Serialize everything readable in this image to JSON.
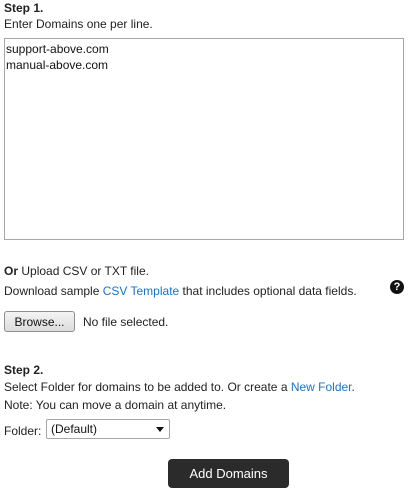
{
  "step1": {
    "heading": "Step 1.",
    "instructions": "Enter Domains one per line.",
    "domains_value": "support-above.com\nmanual-above.com"
  },
  "upload": {
    "or_label": "Or",
    "upload_text": " Upload CSV or TXT file.",
    "download_prefix": "Download sample ",
    "template_link": "CSV Template",
    "download_suffix": " that includes optional data fields.",
    "help_icon": "question-circle-icon",
    "help_glyph": "?",
    "browse_label": "Browse...",
    "file_status": "No file selected."
  },
  "step2": {
    "heading": "Step 2.",
    "folder_prefix": "Select Folder for domains to be added to. Or create a ",
    "new_folder_link": "New Folder",
    "folder_suffix": ".",
    "note": "Note: You can move a domain at anytime.",
    "folder_label": "Folder:",
    "folder_selected": "(Default)"
  },
  "actions": {
    "add_domains_label": "Add Domains"
  },
  "colors": {
    "link": "#1a73c7",
    "primary_button_bg": "#2b2b2b",
    "primary_button_text": "#ffffff"
  }
}
